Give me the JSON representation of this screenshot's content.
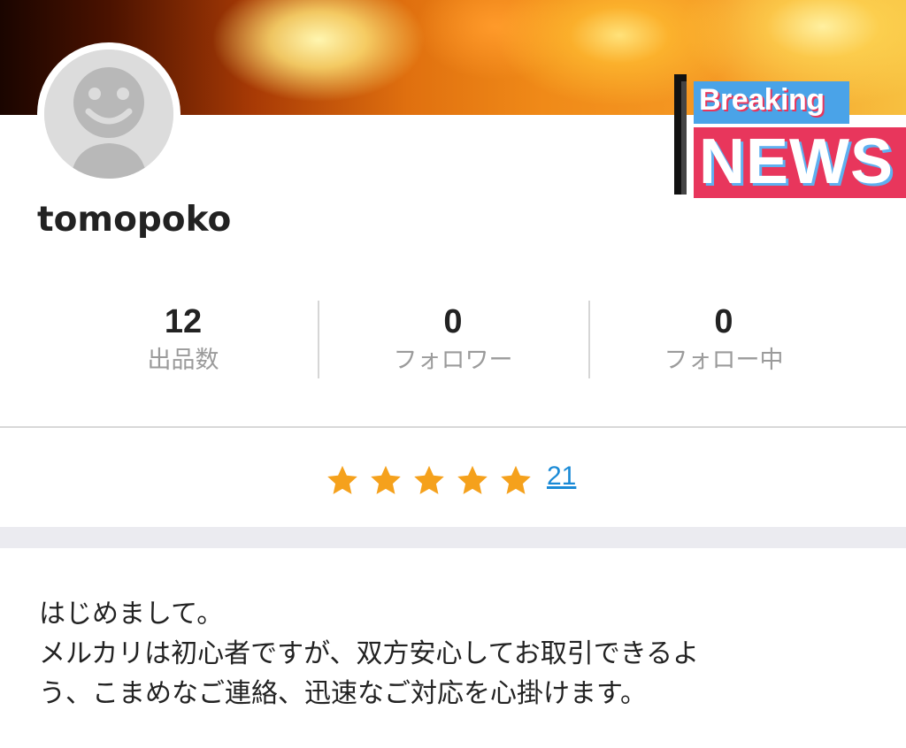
{
  "profile": {
    "username": "tomopoko",
    "avatar_icon": "default-avatar-icon"
  },
  "banner": {
    "breaking": "Breaking",
    "news": "NEWS"
  },
  "stats": [
    {
      "value": "12",
      "label": "出品数"
    },
    {
      "value": "0",
      "label": "フォロワー"
    },
    {
      "value": "0",
      "label": "フォロー中"
    }
  ],
  "rating": {
    "stars": 5,
    "star_color": "#f5a11c",
    "count": "21"
  },
  "intro": {
    "line1": "はじめまして。",
    "line2": "メルカリは初心者ですが、双方安心してお取引できるよ",
    "line3": "う、こまめなご連絡、迅速なご対応を心掛けます。"
  },
  "colors": {
    "link": "#1a8ad6",
    "news_red": "#e8365c",
    "news_blue": "#4aa3e8"
  }
}
